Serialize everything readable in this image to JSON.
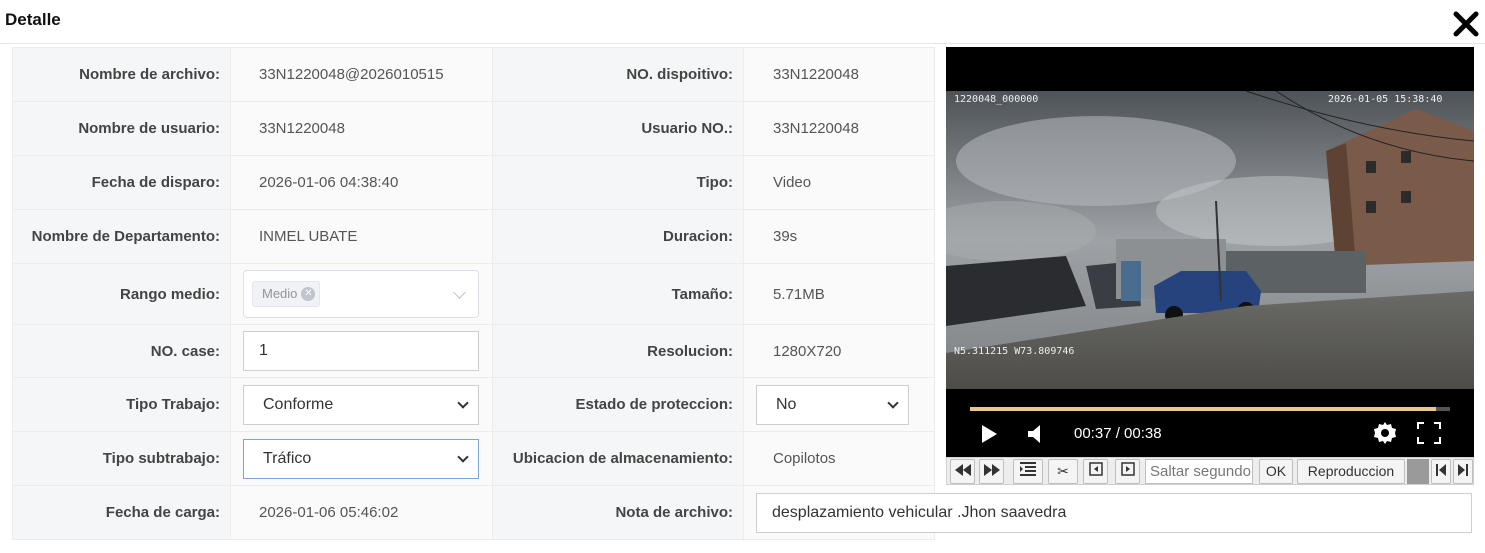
{
  "dialog": {
    "title": "Detalle"
  },
  "details": {
    "file_name_label": "Nombre de archivo:",
    "file_name": "33N1220048@2026010515",
    "device_no_label": "NO. dispoitivo:",
    "device_no": "33N1220048",
    "user_name_label": "Nombre de usuario:",
    "user_name": "33N1220048",
    "user_no_label": "Usuario NO.:",
    "user_no": "33N1220048",
    "trigger_date_label": "Fecha de disparo:",
    "trigger_date": "2026-01-06 04:38:40",
    "type_label": "Tipo:",
    "type": "Video",
    "department_label": "Nombre de Departamento:",
    "department": "INMEL UBATE",
    "duration_label": "Duracion:",
    "duration": "39s",
    "media_range_label": "Rango medio:",
    "media_range_tag": "Medio",
    "size_label": "Tamaño:",
    "size": "5.71MB",
    "case_no_label": "NO. case:",
    "case_no": "1",
    "resolution_label": "Resolucion:",
    "resolution": "1280X720",
    "work_type_label": "Tipo Trabajo:",
    "work_type": "Conforme",
    "protection_label": "Estado de proteccion:",
    "protection": "No",
    "work_subtype_label": "Tipo subtrabajo:",
    "work_subtype": "Tráfico",
    "storage_label": "Ubicacion de almacenamiento:",
    "storage": "Copilotos",
    "upload_date_label": "Fecha de carga:",
    "upload_date": "2026-01-06 05:46:02",
    "note_label": "Nota de archivo:",
    "note": "desplazamiento vehicular .Jhon saavedra"
  },
  "player": {
    "osd_left": "1220048_000000",
    "osd_right": "2026-01-05  15:38:40",
    "osd_gps": "N5.311215  W73.809746",
    "time": "00:37 / 00:38",
    "progress": 0.97
  },
  "toolbar": {
    "seek_placeholder": "Saltar segundo",
    "ok_label": "OK",
    "playback_label": "Reproduccion"
  },
  "colors": {
    "progress": "#e8c98a",
    "player_bg": "#000000",
    "label_bg": "#f5f6f7"
  }
}
